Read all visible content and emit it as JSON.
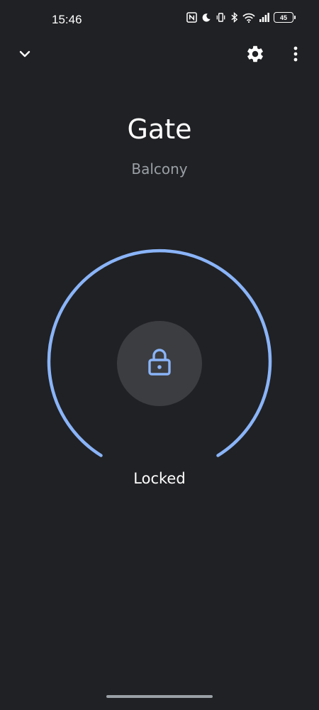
{
  "status_bar": {
    "time": "15:46",
    "icons": [
      "nfc-icon",
      "moon-icon",
      "vibrate-icon",
      "bluetooth-icon",
      "wifi-icon",
      "cell-signal-icon"
    ],
    "battery_level": "45"
  },
  "header": {
    "back_icon": "chevron-down-icon",
    "settings_icon": "gear-icon",
    "more_icon": "more-vert-icon"
  },
  "device": {
    "name": "Gate",
    "room": "Balcony"
  },
  "lock": {
    "status": "Locked",
    "icon": "lock-icon",
    "accent_color": "#8ab4f8",
    "button_color": "#3c3d40"
  },
  "theme": {
    "background": "#202124",
    "text_primary": "#ffffff",
    "text_secondary": "#9aa0a6"
  }
}
